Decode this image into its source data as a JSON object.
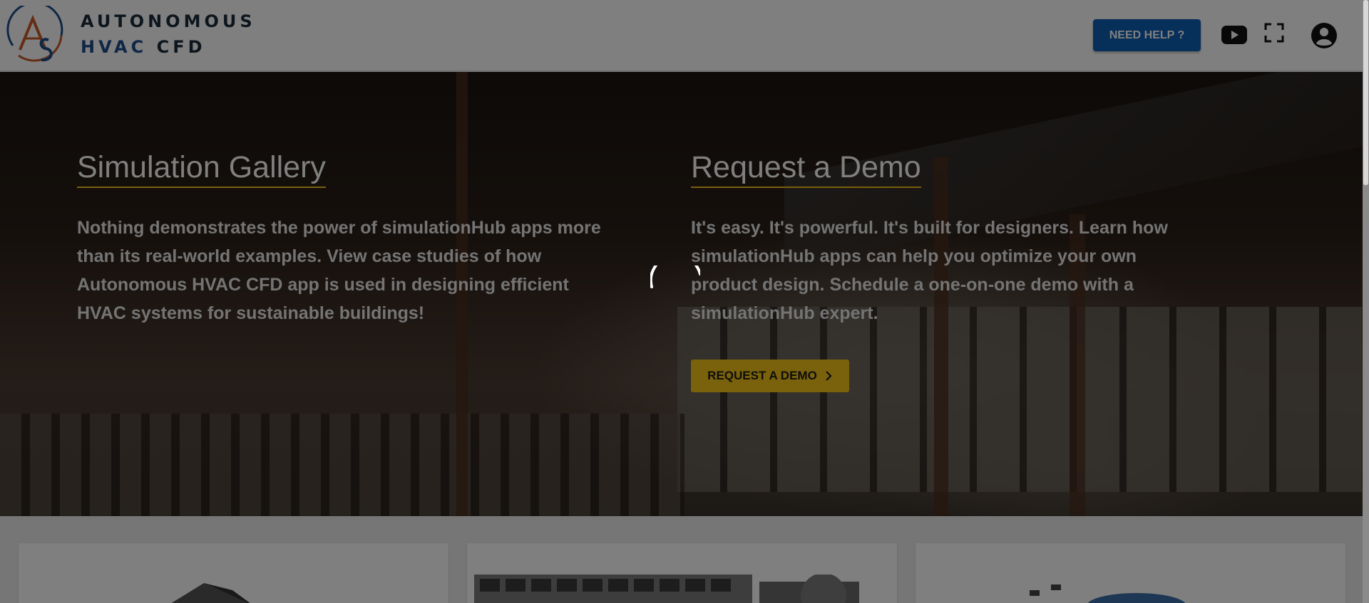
{
  "header": {
    "brand_line1": "AUTONOMOUS",
    "brand_line2_word1": "HVAC",
    "brand_line2_word2": "CFD",
    "help_button": "NEED HELP ?",
    "icons": [
      "youtube-icon",
      "fullscreen-icon",
      "account-icon"
    ]
  },
  "hero": {
    "gallery": {
      "title": "Simulation Gallery",
      "text": "Nothing demonstrates the power of simulationHub apps more than its real-world examples. View case studies of how Autonomous HVAC CFD app is used in designing efficient HVAC systems for sustainable buildings!"
    },
    "demo": {
      "title": "Request a Demo",
      "text": "It's easy. It's powerful. It's built for designers. Learn how simulationHub apps can help you optimize your own product design. Schedule a one-on-one demo with a simulationHub expert.",
      "button": "REQUEST A DEMO"
    }
  },
  "colors": {
    "primary": "#0d5fb4",
    "accent": "#f5c518",
    "logo_orange": "#c85a28",
    "logo_blue": "#1e4f8c"
  },
  "overlay": {
    "loading": true
  }
}
